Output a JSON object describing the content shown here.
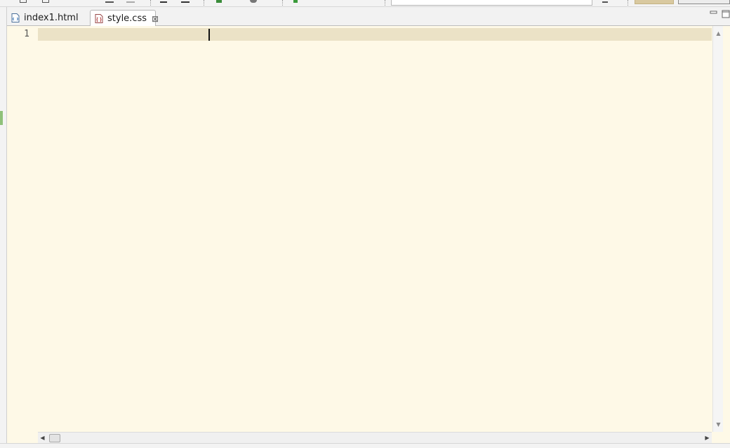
{
  "tabs": [
    {
      "label": "index1.html",
      "icon": "html-file-icon",
      "active": false
    },
    {
      "label": "style.css",
      "icon": "css-file-icon",
      "active": true
    }
  ],
  "editor": {
    "line_numbers": [
      "1"
    ]
  },
  "icons": {
    "close": "⊠",
    "arrow_up": "▲",
    "arrow_down": "▼",
    "arrow_left": "◀",
    "arrow_right": "▶"
  },
  "colors": {
    "editor_bg": "#fef9e7",
    "current_line": "#ebe2c6",
    "accent_button": "#d9c9a0"
  }
}
